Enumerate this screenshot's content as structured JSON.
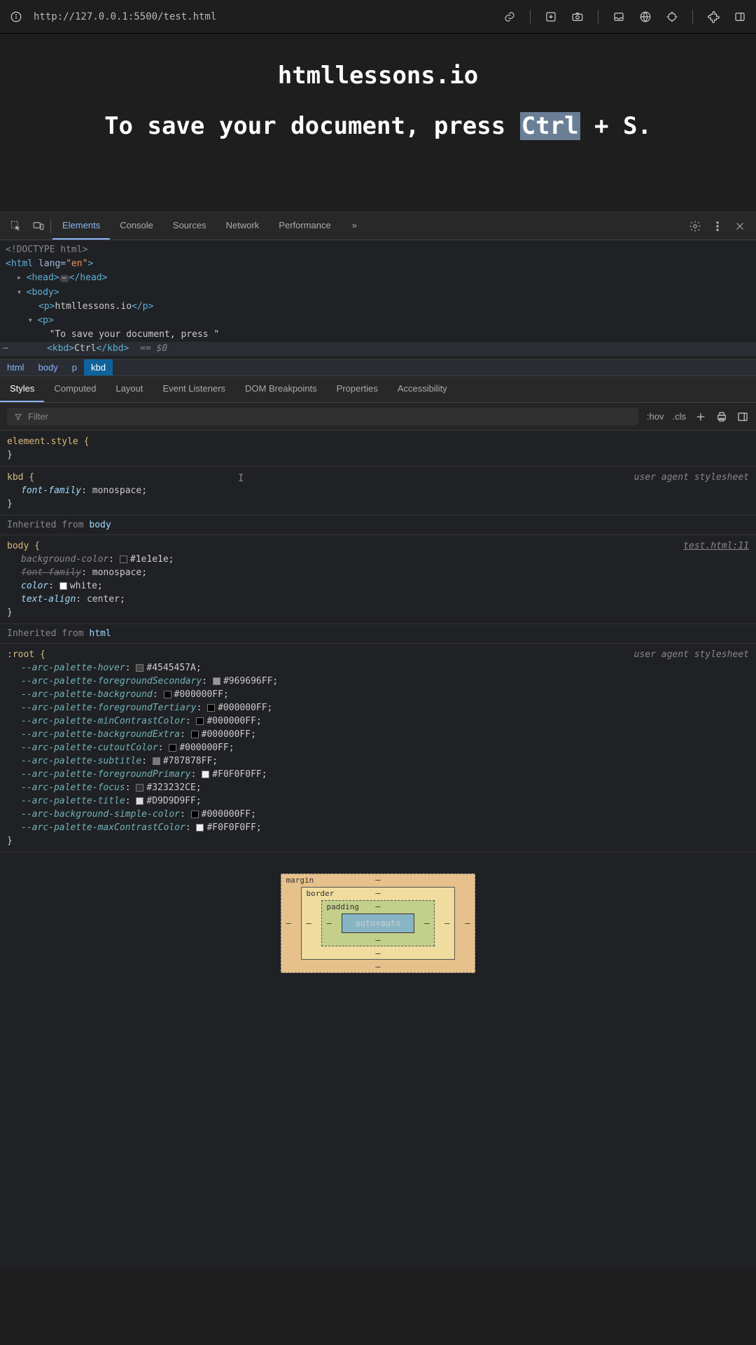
{
  "url_bar": {
    "url": "http://127.0.0.1:5500/test.html"
  },
  "rendered_page": {
    "title": "htmllessons.io",
    "instruction_prefix": "To save your document, press ",
    "kbd": "Ctrl",
    "instruction_mid": " + S."
  },
  "devtools": {
    "main_tabs": [
      "Elements",
      "Console",
      "Sources",
      "Network",
      "Performance"
    ],
    "main_active": "Elements",
    "dom": {
      "doctype": "<!DOCTYPE html>",
      "html_open": "<html lang=\"en\">",
      "head": "<head>⋯</head>",
      "body_open": "<body>",
      "p1": "htmllessons.io",
      "p2_open": "<p>",
      "p2_text": "\"To save your document, press \"",
      "kbd_line": "<kbd>Ctrl</kbd>",
      "eq0": "== $0"
    },
    "breadcrumb": [
      "html",
      "body",
      "p",
      "kbd"
    ],
    "breadcrumb_active": "kbd",
    "styles_tabs": [
      "Styles",
      "Computed",
      "Layout",
      "Event Listeners",
      "DOM Breakpoints",
      "Properties",
      "Accessibility"
    ],
    "styles_active": "Styles",
    "filter_placeholder": "Filter",
    "filter_hov": ":hov",
    "filter_cls": ".cls",
    "rule_elstyle": "element.style {",
    "rule_kbd_sel": "kbd {",
    "rule_kbd_prop": "font-family",
    "rule_kbd_val": "monospace;",
    "rule_kbd_src": "user agent stylesheet",
    "inh_body": "Inherited from ",
    "inh_body_link": "body",
    "rule_body_sel": "body {",
    "rule_body_src": "test.html:11",
    "rule_body_props": [
      {
        "name": "background-color",
        "val": "#1e1e1e;",
        "swatch": "#1e1e1e",
        "struck": false,
        "dim": true
      },
      {
        "name": "font-family",
        "val": "monospace;",
        "swatch": null,
        "struck": true
      },
      {
        "name": "color",
        "val": "white;",
        "swatch": "#ffffff",
        "struck": false
      },
      {
        "name": "text-align",
        "val": "center;",
        "swatch": null,
        "struck": false
      }
    ],
    "inh_html": "Inherited from ",
    "inh_html_link": "html",
    "rule_root_sel": ":root {",
    "rule_root_src": "user agent stylesheet",
    "rule_root_vars": [
      {
        "name": "--arc-palette-hover",
        "val": "#4545457A;",
        "swatch": "#454545"
      },
      {
        "name": "--arc-palette-foregroundSecondary",
        "val": "#969696FF;",
        "swatch": "#969696"
      },
      {
        "name": "--arc-palette-background",
        "val": "#000000FF;",
        "swatch": "#000000"
      },
      {
        "name": "--arc-palette-foregroundTertiary",
        "val": "#000000FF;",
        "swatch": "#000000"
      },
      {
        "name": "--arc-palette-minContrastColor",
        "val": "#000000FF;",
        "swatch": "#000000"
      },
      {
        "name": "--arc-palette-backgroundExtra",
        "val": "#000000FF;",
        "swatch": "#000000"
      },
      {
        "name": "--arc-palette-cutoutColor",
        "val": "#000000FF;",
        "swatch": "#000000"
      },
      {
        "name": "--arc-palette-subtitle",
        "val": "#787878FF;",
        "swatch": "#787878"
      },
      {
        "name": "--arc-palette-foregroundPrimary",
        "val": "#F0F0F0FF;",
        "swatch": "#F0F0F0"
      },
      {
        "name": "--arc-palette-focus",
        "val": "#323232CE;",
        "swatch": "#323232"
      },
      {
        "name": "--arc-palette-title",
        "val": "#D9D9D9FF;",
        "swatch": "#D9D9D9"
      },
      {
        "name": "--arc-background-simple-color",
        "val": "#000000FF;",
        "swatch": "#000000"
      },
      {
        "name": "--arc-palette-maxContrastColor",
        "val": "#F0F0F0FF;",
        "swatch": "#F0F0F0"
      }
    ],
    "boxmodel": {
      "margin_label": "margin",
      "border_label": "border",
      "padding_label": "padding",
      "content": "auto×auto",
      "dash": "–"
    }
  }
}
